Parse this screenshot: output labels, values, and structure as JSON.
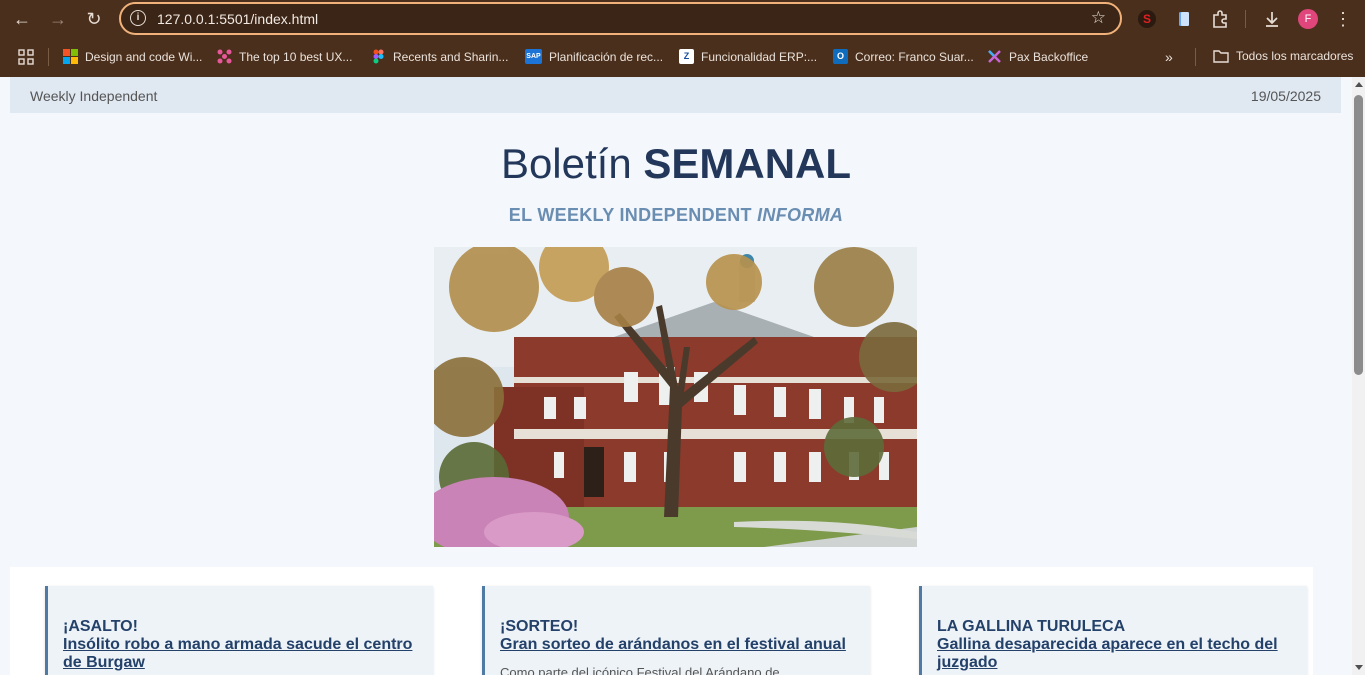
{
  "browser": {
    "url": "127.0.0.1:5501/index.html",
    "profile_initial": "F",
    "bookmarks": [
      {
        "label": "Design and code Wi...",
        "icon": "microsoft-icon"
      },
      {
        "label": "The top 10 best UX...",
        "icon": "dots-icon"
      },
      {
        "label": "Recents and Sharin...",
        "icon": "figma-icon"
      },
      {
        "label": "Planificación de rec...",
        "icon": "sap-icon"
      },
      {
        "label": "Funcionalidad ERP:...",
        "icon": "z-icon"
      },
      {
        "label": "Correo: Franco Suar...",
        "icon": "outlook-icon"
      },
      {
        "label": "Pax Backoffice",
        "icon": "pax-icon"
      }
    ],
    "all_bookmarks_label": "Todos los marcadores",
    "sap_badge": "SAP",
    "z_badge": "Z",
    "outlook_badge": "O",
    "ext_badge": "S"
  },
  "page": {
    "brand": "Weekly Independent",
    "date": "19/05/2025",
    "headline_light": "Boletín",
    "headline_bold": "SEMANAL",
    "subhead_plain": "EL WEEKLY INDEPENDENT",
    "subhead_em": "INFORMA",
    "articles": [
      {
        "kicker": "¡ASALTO!",
        "title": "Insólito robo a mano armada sacude el centro de Burgaw",
        "body": ""
      },
      {
        "kicker": "¡SORTEO!",
        "title": "Gran sorteo de arándanos en el festival anual",
        "body": "Como parte del icónico Festival del Arándano de"
      },
      {
        "kicker": "LA GALLINA TURULECA",
        "title": "Gallina desaparecida aparece en el techo del juzgado",
        "body": ""
      }
    ]
  },
  "colors": {
    "chrome": "#4a2f1c",
    "accent": "#22375a",
    "subhead": "#6a8db2"
  }
}
